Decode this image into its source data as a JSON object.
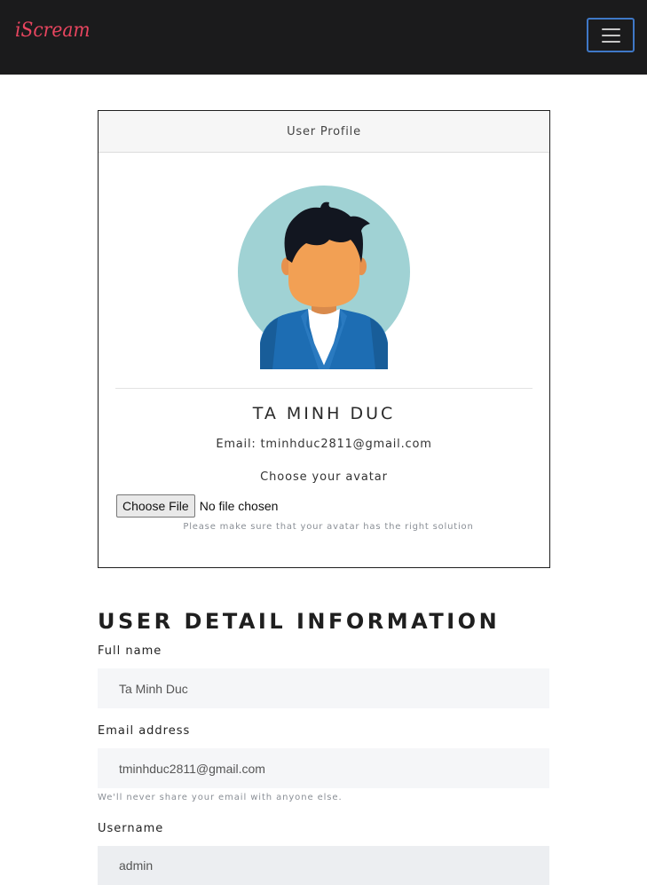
{
  "navbar": {
    "brand": "iScream",
    "toggle_icon": "hamburger-menu-icon"
  },
  "profile_card": {
    "header": "User Profile",
    "avatar_icon": "user-avatar-icon",
    "name": "TA MINH DUC",
    "email_line": "Email: tminhduc2811@gmail.com",
    "choose_avatar_label": "Choose your avatar",
    "file_button": "Choose File",
    "file_status": "No file chosen",
    "file_hint": "Please make sure that your avatar has the right solution"
  },
  "details": {
    "title": "USER DETAIL INFORMATION",
    "full_name_label": "Full name",
    "full_name_value": "Ta Minh Duc",
    "email_label": "Email address",
    "email_value": "tminhduc2811@gmail.com",
    "email_help": "We'll never share your email with anyone else.",
    "username_label": "Username",
    "username_value": "admin"
  },
  "colors": {
    "navbar_bg": "#1b1b1c",
    "brand": "#e8455f",
    "toggler_border": "#3f78c7"
  }
}
